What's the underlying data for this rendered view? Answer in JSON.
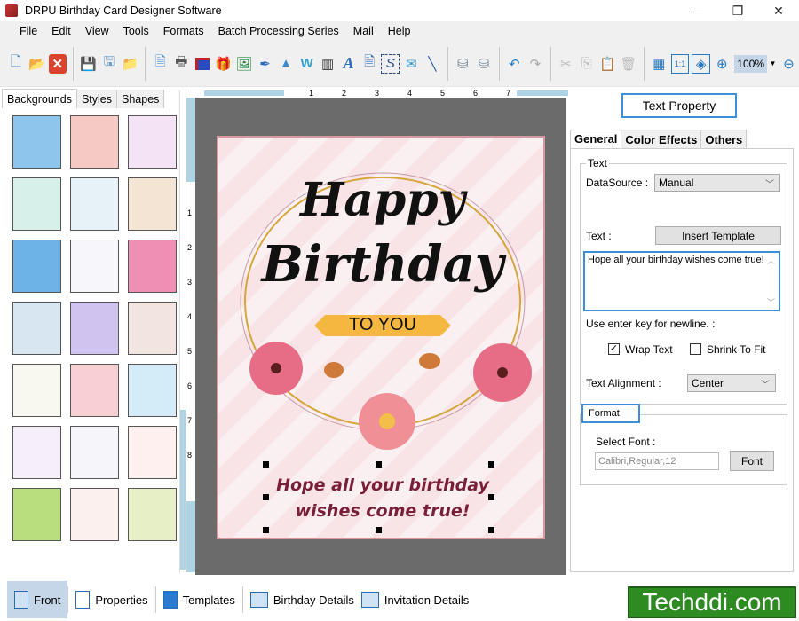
{
  "window": {
    "title": "DRPU Birthday Card Designer Software",
    "minimize": "—",
    "maximize": "❐",
    "close": "✕"
  },
  "menu": [
    "File",
    "Edit",
    "View",
    "Tools",
    "Formats",
    "Batch Processing Series",
    "Mail",
    "Help"
  ],
  "toolbar": {
    "icons": [
      "new-icon",
      "open-icon",
      "close-icon",
      "save-icon",
      "save-as-icon",
      "open-folder-icon",
      "properties-icon",
      "print-icon",
      "copy-layers-icon",
      "gift-icon",
      "insert-image-icon",
      "pen-icon",
      "shapes-icon",
      "wordart-icon",
      "barcode-icon",
      "text-icon",
      "text-box-icon",
      "signature-icon",
      "mail-icon",
      "line-icon",
      "database-icon",
      "database-2-icon",
      "undo-icon",
      "redo-icon",
      "cut-icon",
      "copy-icon",
      "paste-icon",
      "delete-icon",
      "grid-icon",
      "actual-size-icon",
      "fit-icon",
      "zoom-in-icon",
      "zoom-out-icon"
    ],
    "zoom": "100%"
  },
  "left_panel": {
    "tabs": [
      "Backgrounds",
      "Styles",
      "Shapes"
    ],
    "active_tab": "Backgrounds",
    "thumbnails": [
      {
        "name": "clouds",
        "color": "#8cc6ec"
      },
      {
        "name": "pink-floral",
        "color": "#f6c9c4"
      },
      {
        "name": "butterflies",
        "color": "#f3e3f5"
      },
      {
        "name": "daisies",
        "color": "#d7f0ea"
      },
      {
        "name": "kids-drawing",
        "color": "#e6f1f8"
      },
      {
        "name": "bird-balloons",
        "color": "#f3e4d3"
      },
      {
        "name": "stars",
        "color": "#6db3e8"
      },
      {
        "name": "balloons",
        "color": "#f7f7fb"
      },
      {
        "name": "pink-pattern",
        "color": "#ef8fb4"
      },
      {
        "name": "bubbles",
        "color": "#d8e6f1"
      },
      {
        "name": "rainbow",
        "color": "#d0c3ef"
      },
      {
        "name": "teddy",
        "color": "#f2e5df"
      },
      {
        "name": "happy-birthday",
        "color": "#f8f8f0"
      },
      {
        "name": "pink-hearts",
        "color": "#f8d0d4"
      },
      {
        "name": "balloons-sky",
        "color": "#d4ecf8"
      },
      {
        "name": "outline-hearts",
        "color": "#f6eef9"
      },
      {
        "name": "balloon-bunches",
        "color": "#f5f5fa"
      },
      {
        "name": "red-hearts",
        "color": "#fff0f0"
      },
      {
        "name": "green-stripes",
        "color": "#b9de7d"
      },
      {
        "name": "cakes",
        "color": "#fbf0ee"
      },
      {
        "name": "garden",
        "color": "#e6efc6"
      }
    ]
  },
  "ruler": {
    "h_ticks": [
      "1",
      "2",
      "3",
      "4",
      "5",
      "6",
      "7"
    ],
    "v_ticks": [
      "1",
      "2",
      "3",
      "4",
      "5",
      "6",
      "7",
      "8"
    ]
  },
  "card": {
    "line1": "Happy",
    "line2": "Birthday",
    "banner": "TO YOU",
    "message_line1": "Hope all your birthday",
    "message_line2": "wishes come true!"
  },
  "right_panel": {
    "header": "Text Property",
    "tabs": [
      "General",
      "Color Effects",
      "Others"
    ],
    "active_tab": "General",
    "text_group": "Text",
    "datasource_label": "DataSource :",
    "datasource_value": "Manual",
    "text_label": "Text :",
    "insert_template": "Insert Template",
    "text_value": "Hope all your birthday wishes come true!",
    "newline_hint": "Use enter key for newline. :",
    "wrap_text": {
      "label": "Wrap Text",
      "checked": true
    },
    "shrink_to_fit": {
      "label": "Shrink To Fit",
      "checked": false
    },
    "alignment_label": "Text Alignment :",
    "alignment_value": "Center",
    "format_group": "Format",
    "select_font_label": "Select Font :",
    "font_value": "Calibri,Regular,12",
    "font_button": "Font"
  },
  "bottom_tabs": [
    {
      "label": "Front",
      "active": true
    },
    {
      "label": "Properties",
      "active": false
    },
    {
      "label": "Templates",
      "active": false
    },
    {
      "label": "Birthday Details",
      "active": false
    },
    {
      "label": "Invitation Details",
      "active": false
    }
  ],
  "watermark": "Techddi.com"
}
